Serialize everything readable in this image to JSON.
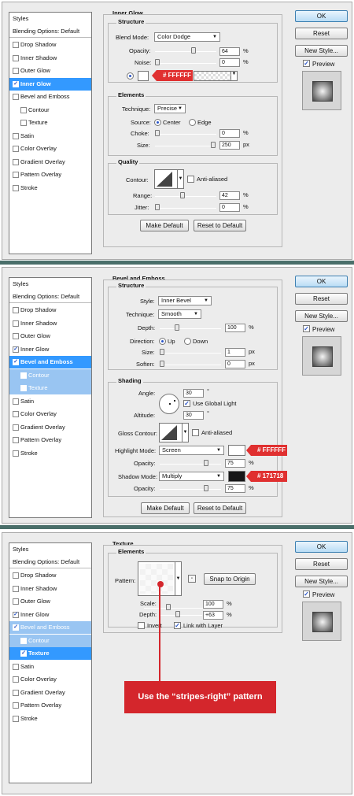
{
  "panels": [
    {
      "styles_title": "Styles",
      "blending": "Blending Options: Default",
      "items": [
        {
          "label": "Drop Shadow",
          "checked": false,
          "state": ""
        },
        {
          "label": "Inner Shadow",
          "checked": false,
          "state": ""
        },
        {
          "label": "Outer Glow",
          "checked": false,
          "state": ""
        },
        {
          "label": "Inner Glow",
          "checked": true,
          "state": "sel"
        },
        {
          "label": "Bevel and Emboss",
          "checked": false,
          "state": ""
        },
        {
          "label": "Contour",
          "checked": false,
          "state": "indent"
        },
        {
          "label": "Texture",
          "checked": false,
          "state": "indent"
        },
        {
          "label": "Satin",
          "checked": false,
          "state": ""
        },
        {
          "label": "Color Overlay",
          "checked": false,
          "state": ""
        },
        {
          "label": "Gradient Overlay",
          "checked": false,
          "state": ""
        },
        {
          "label": "Pattern Overlay",
          "checked": false,
          "state": ""
        },
        {
          "label": "Stroke",
          "checked": false,
          "state": ""
        }
      ]
    },
    {
      "styles_title": "Styles",
      "blending": "Blending Options: Default",
      "items": [
        {
          "label": "Drop Shadow",
          "checked": false,
          "state": ""
        },
        {
          "label": "Inner Shadow",
          "checked": false,
          "state": ""
        },
        {
          "label": "Outer Glow",
          "checked": false,
          "state": ""
        },
        {
          "label": "Inner Glow",
          "checked": true,
          "state": ""
        },
        {
          "label": "Bevel and Emboss",
          "checked": true,
          "state": "sel"
        },
        {
          "label": "Contour",
          "checked": false,
          "state": "sub indent"
        },
        {
          "label": "Texture",
          "checked": false,
          "state": "sub indent"
        },
        {
          "label": "Satin",
          "checked": false,
          "state": ""
        },
        {
          "label": "Color Overlay",
          "checked": false,
          "state": ""
        },
        {
          "label": "Gradient Overlay",
          "checked": false,
          "state": ""
        },
        {
          "label": "Pattern Overlay",
          "checked": false,
          "state": ""
        },
        {
          "label": "Stroke",
          "checked": false,
          "state": ""
        }
      ]
    },
    {
      "styles_title": "Styles",
      "blending": "Blending Options: Default",
      "items": [
        {
          "label": "Drop Shadow",
          "checked": false,
          "state": ""
        },
        {
          "label": "Inner Shadow",
          "checked": false,
          "state": ""
        },
        {
          "label": "Outer Glow",
          "checked": false,
          "state": ""
        },
        {
          "label": "Inner Glow",
          "checked": true,
          "state": ""
        },
        {
          "label": "Bevel and Emboss",
          "checked": true,
          "state": "sub"
        },
        {
          "label": "Contour",
          "checked": false,
          "state": "sub indent"
        },
        {
          "label": "Texture",
          "checked": true,
          "state": "sel indent"
        },
        {
          "label": "Satin",
          "checked": false,
          "state": ""
        },
        {
          "label": "Color Overlay",
          "checked": false,
          "state": ""
        },
        {
          "label": "Gradient Overlay",
          "checked": false,
          "state": ""
        },
        {
          "label": "Pattern Overlay",
          "checked": false,
          "state": ""
        },
        {
          "label": "Stroke",
          "checked": false,
          "state": ""
        }
      ]
    }
  ],
  "buttons": {
    "ok": "OK",
    "reset": "Reset",
    "new_style": "New Style...",
    "preview": "Preview"
  },
  "inner_glow": {
    "title": "Inner Glow",
    "structure": "Structure",
    "blend_mode_label": "Blend Mode:",
    "blend_mode": "Color Dodge",
    "opacity_label": "Opacity:",
    "opacity": "64",
    "noise_label": "Noise:",
    "noise": "0",
    "color_hex": "# FFFFFF",
    "elements": "Elements",
    "technique_label": "Technique:",
    "technique": "Precise",
    "source_label": "Source:",
    "source_center": "Center",
    "source_edge": "Edge",
    "choke_label": "Choke:",
    "choke": "0",
    "size_label": "Size:",
    "size": "250",
    "quality": "Quality",
    "contour_label": "Contour:",
    "anti_aliased": "Anti-aliased",
    "range_label": "Range:",
    "range": "42",
    "jitter_label": "Jitter:",
    "jitter": "0",
    "pct": "%",
    "px": "px",
    "make_default": "Make Default",
    "reset_default": "Reset to Default"
  },
  "bevel": {
    "title": "Bevel and Emboss",
    "structure": "Structure",
    "style_label": "Style:",
    "style": "Inner Bevel",
    "technique_label": "Technique:",
    "technique": "Smooth",
    "depth_label": "Depth:",
    "depth": "100",
    "direction_label": "Direction:",
    "dir_up": "Up",
    "dir_down": "Down",
    "size_label": "Size:",
    "size": "1",
    "soften_label": "Soften:",
    "soften": "0",
    "shading": "Shading",
    "angle_label": "Angle:",
    "angle": "30",
    "deg": "°",
    "global_light": "Use Global Light",
    "altitude_label": "Altitude:",
    "altitude": "30",
    "gloss_label": "Gloss Contour:",
    "anti_aliased": "Anti-aliased",
    "highlight_label": "Highlight Mode:",
    "highlight_mode": "Screen",
    "highlight_hex": "# FFFFFF",
    "highlight_opacity": "75",
    "shadow_label": "Shadow Mode:",
    "shadow_mode": "Multiply",
    "shadow_hex": "# 171718",
    "shadow_opacity": "75",
    "opacity_label": "Opacity:",
    "pct": "%",
    "px": "px",
    "make_default": "Make Default",
    "reset_default": "Reset to Default"
  },
  "texture": {
    "title": "Texture",
    "elements": "Elements",
    "pattern_label": "Pattern:",
    "snap": "Snap to Origin",
    "scale_label": "Scale:",
    "scale": "100",
    "depth_label": "Depth:",
    "depth": "+63",
    "invert": "Invert",
    "link": "Link with Layer",
    "pct": "%",
    "callout": "Use the “stripes-right” pattern"
  },
  "colors": {
    "selection": "#3399ff",
    "tag_red": "#e03030",
    "separator": "#4a6f6a"
  }
}
